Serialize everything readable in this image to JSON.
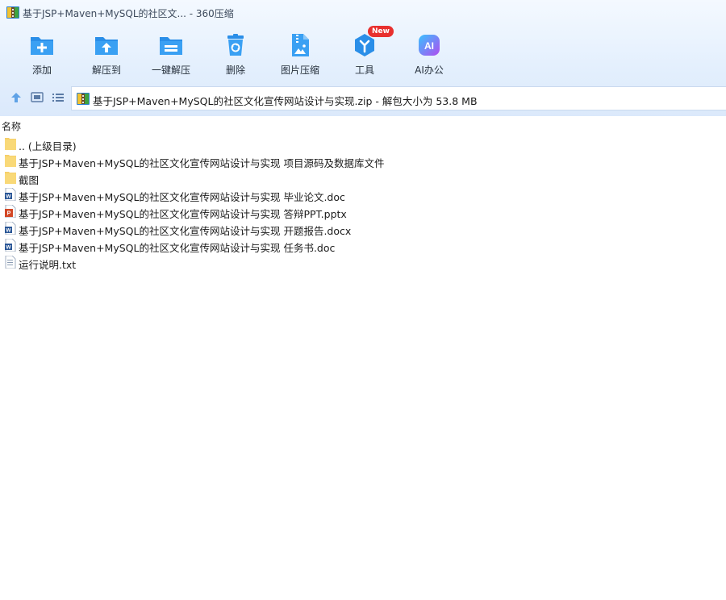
{
  "window": {
    "title": "基于JSP+Maven+MySQL的社区文... - 360压缩"
  },
  "toolbar": {
    "items": [
      {
        "label": "添加",
        "icon": "add-icon"
      },
      {
        "label": "解压到",
        "icon": "extract-to-icon"
      },
      {
        "label": "一键解压",
        "icon": "one-click-extract-icon"
      },
      {
        "label": "删除",
        "icon": "delete-icon"
      },
      {
        "label": "图片压缩",
        "icon": "image-compress-icon"
      },
      {
        "label": "工具",
        "icon": "tools-icon",
        "badge": "New"
      },
      {
        "label": "AI办公",
        "icon": "ai-office-icon",
        "icon_text": "AI"
      }
    ]
  },
  "nav": {
    "path": "基于JSP+Maven+MySQL的社区文化宣传网站设计与实现.zip - 解包大小为 53.8 MB"
  },
  "list": {
    "column_name": "名称",
    "rows": [
      {
        "name": ".. (上级目录)",
        "type": "folder"
      },
      {
        "name": "基于JSP+Maven+MySQL的社区文化宣传网站设计与实现 项目源码及数据库文件",
        "type": "folder"
      },
      {
        "name": "截图",
        "type": "folder"
      },
      {
        "name": "基于JSP+Maven+MySQL的社区文化宣传网站设计与实现 毕业论文.doc",
        "type": "word"
      },
      {
        "name": "基于JSP+Maven+MySQL的社区文化宣传网站设计与实现 答辩PPT.pptx",
        "type": "ppt"
      },
      {
        "name": "基于JSP+Maven+MySQL的社区文化宣传网站设计与实现 开题报告.docx",
        "type": "word"
      },
      {
        "name": "基于JSP+Maven+MySQL的社区文化宣传网站设计与实现 任务书.doc",
        "type": "word"
      },
      {
        "name": "运行说明.txt",
        "type": "text"
      }
    ]
  },
  "colors": {
    "accent": "#2a8ee8",
    "folder": "#f6cf6a",
    "word": "#2b5797",
    "ppt": "#d24726",
    "ai_gradient_start": "#39c2ff",
    "ai_gradient_end": "#b04cf0",
    "badge": "#e8302e"
  }
}
